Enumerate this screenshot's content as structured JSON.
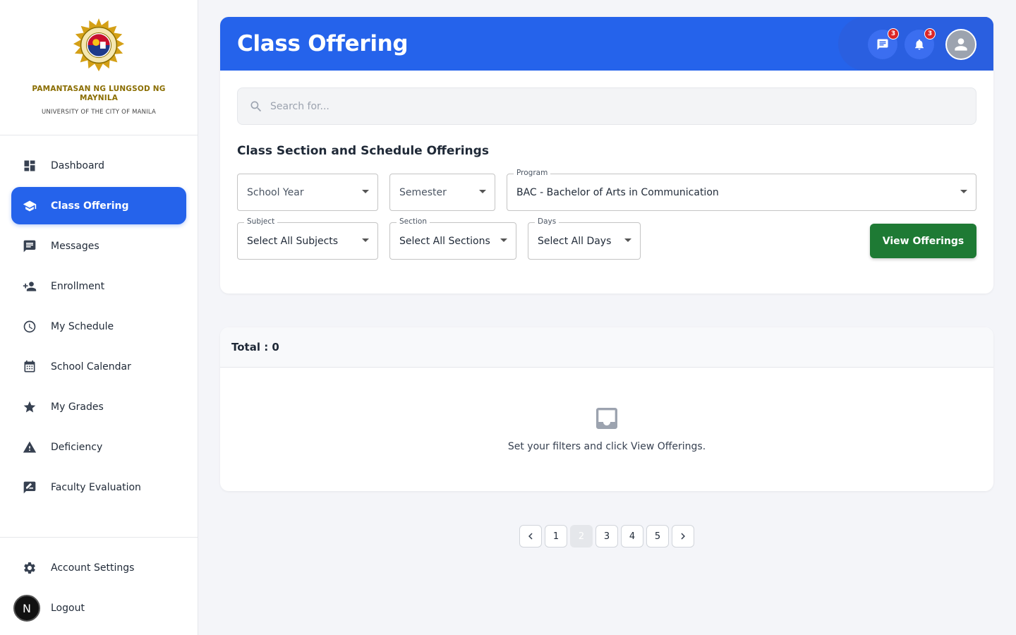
{
  "brand": {
    "name": "PAMANTASAN NG LUNGSOD NG MAYNILA",
    "subtitle": "UNIVERSITY OF THE CITY OF MANILA"
  },
  "sidebar": {
    "items": [
      {
        "label": "Dashboard",
        "icon": "dashboard-icon"
      },
      {
        "label": "Class Offering",
        "icon": "school-icon",
        "active": true
      },
      {
        "label": "Messages",
        "icon": "chat-icon"
      },
      {
        "label": "Enrollment",
        "icon": "person-add-icon"
      },
      {
        "label": "My Schedule",
        "icon": "clock-icon"
      },
      {
        "label": "School Calendar",
        "icon": "calendar-icon"
      },
      {
        "label": "My Grades",
        "icon": "star-icon"
      },
      {
        "label": "Deficiency",
        "icon": "warning-icon"
      },
      {
        "label": "Faculty Evaluation",
        "icon": "rate-review-icon"
      }
    ],
    "bottom": [
      {
        "label": "Account Settings",
        "icon": "gear-icon"
      },
      {
        "label": "Logout",
        "icon": "logout-icon"
      }
    ],
    "user_initial": "N"
  },
  "header": {
    "title": "Class Offering",
    "messages_badge": "3",
    "notifications_badge": "3"
  },
  "search": {
    "placeholder": "Search for..."
  },
  "filters": {
    "section_title": "Class Section and Schedule Offerings",
    "school_year": {
      "value": "School Year"
    },
    "semester": {
      "value": "Semester"
    },
    "program": {
      "label": "Program",
      "value": "BAC - Bachelor of Arts in Communication"
    },
    "subject": {
      "label": "Subject",
      "value": "Select All Subjects"
    },
    "section": {
      "label": "Section",
      "value": "Select All Sections"
    },
    "days": {
      "label": "Days",
      "value": "Select All Days"
    },
    "view_button": "View Offerings"
  },
  "results": {
    "total_label": "Total : 0",
    "empty_text": "Set your filters and click View Offerings."
  },
  "pagination": {
    "pages": [
      "1",
      "2",
      "3",
      "4",
      "5"
    ],
    "current": "2"
  },
  "colors": {
    "primary": "#2563eb",
    "success": "#1e7a34",
    "badge": "#dc2626",
    "brand_gold": "#8a6d00"
  }
}
